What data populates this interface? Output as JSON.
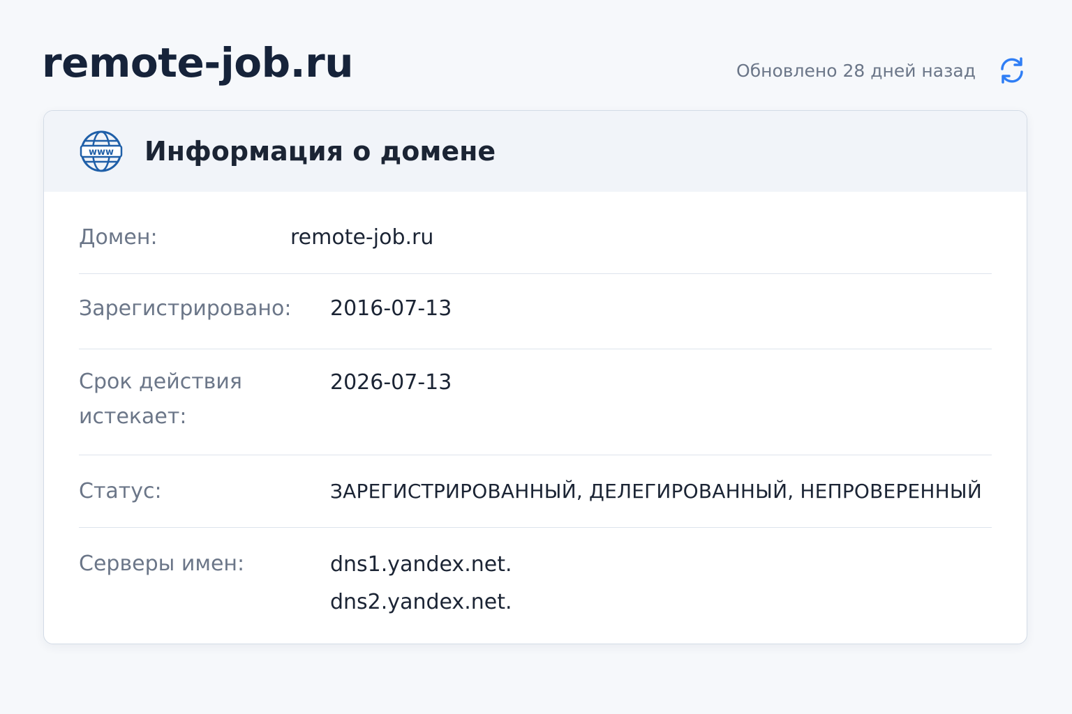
{
  "header": {
    "title": "remote-job.ru",
    "updated_text": "Обновлено 28 дней назад",
    "refresh_icon": "refresh-icon"
  },
  "card": {
    "title": "Информация о домене",
    "icon": "globe-www-icon",
    "icon_text": "www",
    "rows": {
      "domain": {
        "label": "Домен:",
        "value": "remote-job.ru"
      },
      "registered": {
        "label": "Зарегистрировано:",
        "value": "2016-07-13"
      },
      "expires": {
        "label_line1": "Срок действия",
        "label_line2": "истекает:",
        "value": "2026-07-13"
      },
      "status": {
        "label": "Статус:",
        "value": "ЗАРЕГИСТРИРОВАННЫЙ, ДЕЛЕГИРОВАННЫЙ, НЕПРОВЕРЕННЫЙ"
      },
      "nameservers": {
        "label": "Серверы имен:",
        "values": [
          "dns1.yandex.net.",
          "dns2.yandex.net."
        ]
      }
    }
  },
  "colors": {
    "accent": "#2f7ef5",
    "icon_blue": "#1f5fa8",
    "label_gray": "#6b7688",
    "text_dark": "#1b2434"
  }
}
